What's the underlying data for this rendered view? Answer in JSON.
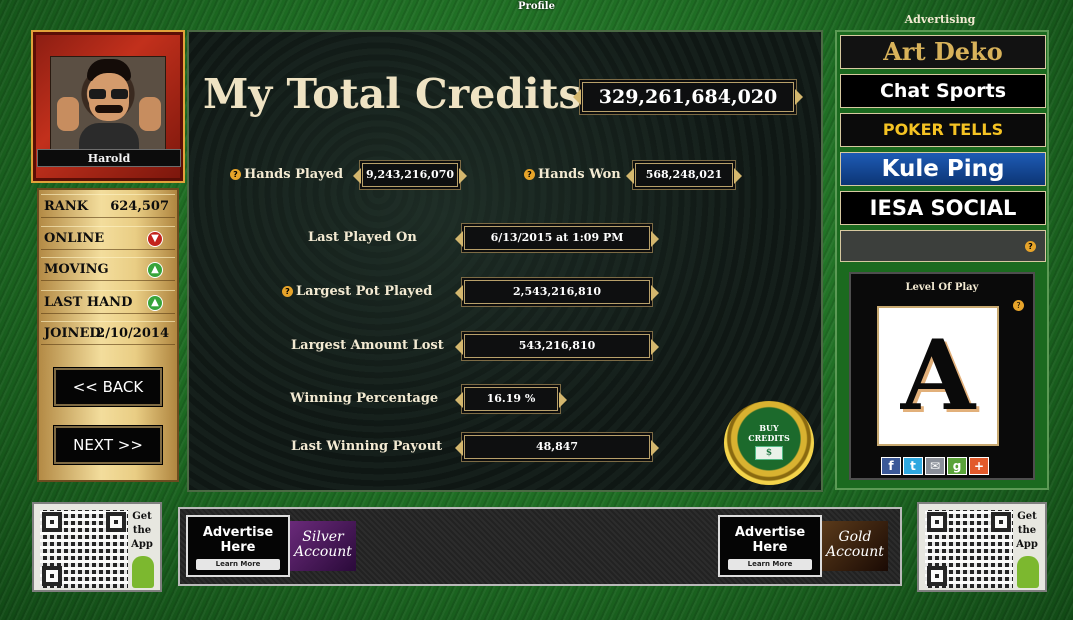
{
  "window": {
    "title": "Profile"
  },
  "player": {
    "name": "Harold"
  },
  "stats": {
    "rank_label": "RANK",
    "rank_value": "624,507",
    "online_label": "ONLINE",
    "moving_label": "MOVING",
    "last_hand_label": "LAST HAND",
    "joined_label": "JOINED",
    "joined_value": "2/10/2014"
  },
  "nav": {
    "back_label": "<< BACK",
    "next_label": "NEXT >>"
  },
  "main": {
    "title": "My Total Credits",
    "total_credits": "329,261,684,020",
    "hands_played_label": "Hands Played",
    "hands_played_value": "9,243,216,070",
    "hands_won_label": "Hands Won",
    "hands_won_value": "568,248,021",
    "last_played_label": "Last Played On",
    "last_played_value": "6/13/2015 at 1:09 PM",
    "largest_pot_label": "Largest Pot Played",
    "largest_pot_value": "2,543,216,810",
    "largest_lost_label": "Largest Amount Lost",
    "largest_lost_value": "543,216,810",
    "winning_pct_label": "Winning Percentage",
    "winning_pct_value": "16.19 %",
    "last_payout_label": "Last Winning Payout",
    "last_payout_value": "48,847",
    "buy_line1": "BUY",
    "buy_line2": "CREDITS",
    "buy_cash": "$"
  },
  "sidebar": {
    "header": "Advertising",
    "ads": [
      "Art Deko",
      "Chat Sports",
      "POKER TELLS",
      "Kule Ping",
      "IESA SOCIAL"
    ],
    "level_title": "Level Of Play",
    "level_value": "A",
    "social_icons": [
      "facebook-icon",
      "twitter-icon",
      "email-icon",
      "google-plus-icon",
      "add-icon"
    ]
  },
  "bottom": {
    "get_app_line1": "Get",
    "get_app_line2": "the",
    "get_app_line3": "App",
    "advertise_line1": "Advertise",
    "advertise_line2": "Here",
    "learn_more": "Learn More",
    "silver_line1": "Silver",
    "silver_line2": "Account",
    "gold_line1": "Gold",
    "gold_line2": "Account"
  },
  "colors": {
    "felt_green": "#1d6a22",
    "gold": "#d4b76e",
    "panel_dark": "#0a0f0d"
  }
}
